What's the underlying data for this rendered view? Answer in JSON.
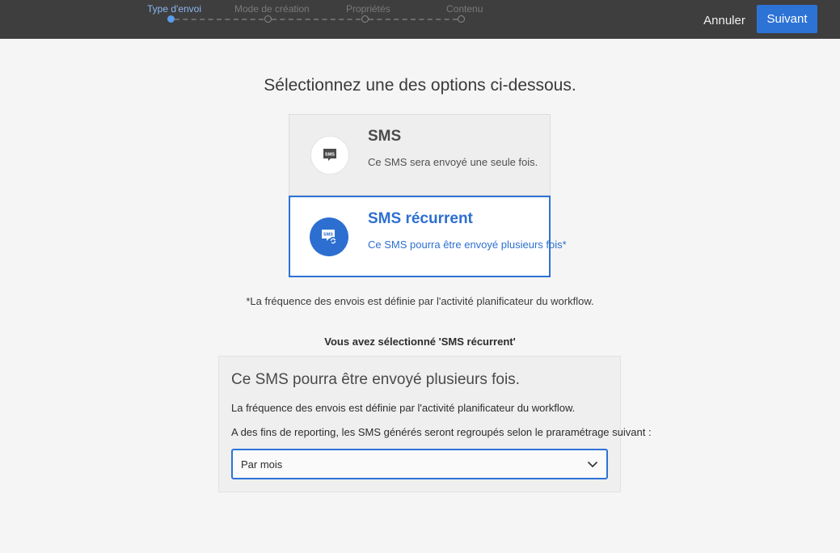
{
  "wizard": {
    "steps": [
      {
        "label": "Type d'envoi",
        "active": true
      },
      {
        "label": "Mode de création",
        "active": false
      },
      {
        "label": "Propriétés",
        "active": false
      },
      {
        "label": "Contenu",
        "active": false
      }
    ]
  },
  "toolbar": {
    "cancel_label": "Annuler",
    "next_label": "Suivant"
  },
  "main": {
    "heading": "Sélectionnez une des options ci-dessous.",
    "options": [
      {
        "title": "SMS",
        "description": "Ce SMS sera envoyé une seule fois.",
        "icon": "sms-bubble-icon",
        "icon_text": "SMS",
        "selected": false
      },
      {
        "title": "SMS récurrent",
        "description": "Ce SMS pourra être envoyé plusieurs fois*",
        "icon": "recurring-sms-icon",
        "icon_text": "SMS",
        "selected": true
      }
    ],
    "footnote": "*La fréquence des envois est définie par l'activité planificateur du workflow.",
    "selected_title": "Vous avez sélectionné 'SMS récurrent'"
  },
  "panel": {
    "title": "Ce SMS pourra être envoyé plusieurs fois.",
    "line1": "La fréquence des envois est définie par l'activité planificateur du workflow.",
    "line2": "A des fins de reporting, les SMS générés seront regroupés selon le praramétrage suivant :",
    "grouping_select": {
      "value": "Par mois"
    }
  },
  "colors": {
    "accent": "#2d73d6",
    "topbar": "#3e3e3e",
    "background": "#f5f5f5"
  }
}
